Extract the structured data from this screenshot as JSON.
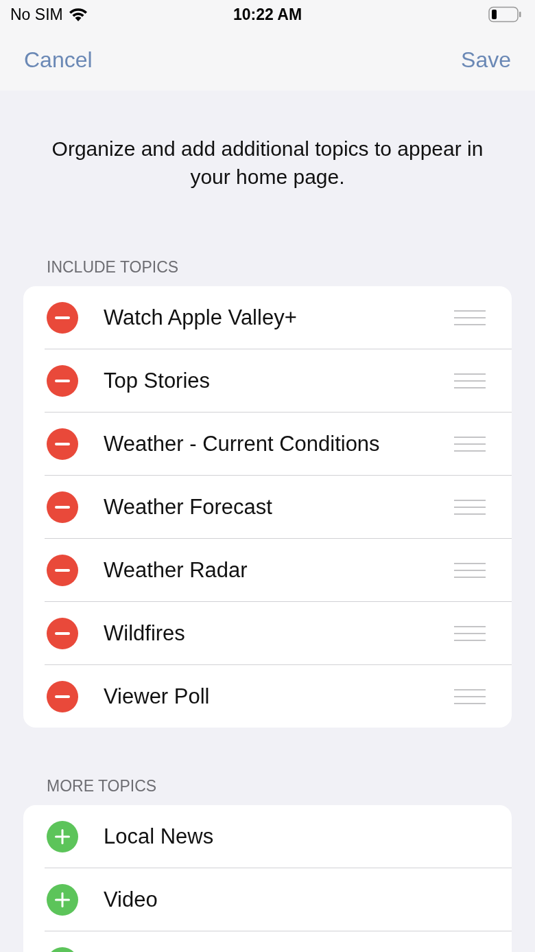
{
  "status_bar": {
    "carrier": "No SIM",
    "time": "10:22 AM"
  },
  "nav": {
    "cancel": "Cancel",
    "save": "Save"
  },
  "intro": "Organize and add additional topics to appear in your home page.",
  "sections": [
    {
      "header": "INCLUDE TOPICS",
      "items": [
        {
          "kind": "remove",
          "label": "Watch Apple Valley+"
        },
        {
          "kind": "remove",
          "label": "Top Stories"
        },
        {
          "kind": "remove",
          "label": "Weather - Current Conditions"
        },
        {
          "kind": "remove",
          "label": "Weather Forecast"
        },
        {
          "kind": "remove",
          "label": "Weather Radar"
        },
        {
          "kind": "remove",
          "label": "Wildfires"
        },
        {
          "kind": "remove",
          "label": "Viewer Poll"
        }
      ]
    },
    {
      "header": "MORE TOPICS",
      "items": [
        {
          "kind": "add",
          "label": "Local News"
        },
        {
          "kind": "add",
          "label": "Video"
        },
        {
          "kind": "add"
        }
      ]
    }
  ]
}
